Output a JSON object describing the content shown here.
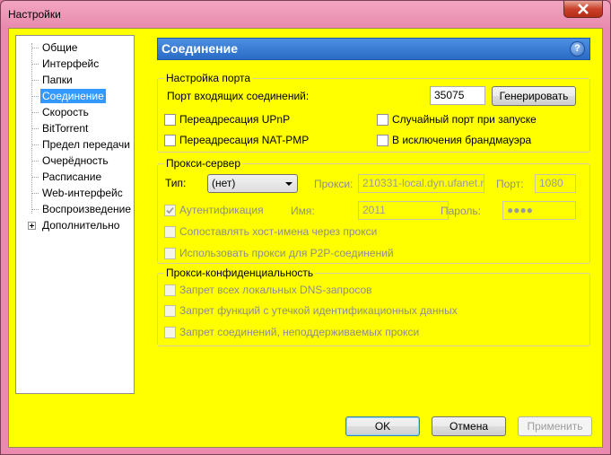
{
  "window": {
    "title": "Настройки"
  },
  "sidebar": {
    "items": [
      {
        "label": "Общие"
      },
      {
        "label": "Интерфейс"
      },
      {
        "label": "Папки"
      },
      {
        "label": "Соединение"
      },
      {
        "label": "Скорость"
      },
      {
        "label": "BitTorrent"
      },
      {
        "label": "Предел передачи"
      },
      {
        "label": "Очерёдность"
      },
      {
        "label": "Расписание"
      },
      {
        "label": "Web-интерфейс"
      },
      {
        "label": "Воспроизведение"
      },
      {
        "label": "Дополнительно"
      }
    ],
    "selected": "Соединение"
  },
  "header": {
    "title": "Соединение",
    "help": "?"
  },
  "port": {
    "group_label": "Настройка порта",
    "incoming_label": "Порт входящих соединений:",
    "incoming_value": "35075",
    "generate_label": "Генерировать",
    "upnp_label": "Переадресация UPnP",
    "natpmp_label": "Переадресация NAT-PMP",
    "random_label": "Случайный порт при запуске",
    "firewall_label": "В исключения брандмауэра",
    "upnp_checked": false,
    "natpmp_checked": false,
    "random_checked": false,
    "firewall_checked": false
  },
  "proxy": {
    "group_label": "Прокси-сервер",
    "type_label": "Тип:",
    "type_value": "(нет)",
    "proxy_label": "Прокси:",
    "proxy_value": "210331-local.dyn.ufanet.r",
    "port_label": "Порт:",
    "port_value": "1080",
    "auth_label": "Аутентификация",
    "auth_checked": true,
    "name_label": "Имя:",
    "name_value": "2011",
    "password_label": "Пароль:",
    "password_value": "●●●●",
    "resolve_label": "Сопоставлять хост-имена через прокси",
    "p2p_label": "Использовать прокси для P2P-соединений"
  },
  "privacy": {
    "group_label": "Прокси-конфиденциальность",
    "dns_label": "Запрет всех локальных DNS-запросов",
    "leak_label": "Запрет функций с утечкой идентификационных данных",
    "unsupported_label": "Запрет соединений, неподдерживаемых прокси"
  },
  "footer": {
    "ok_label": "OK",
    "cancel_label": "Отмена",
    "apply_label": "Применить"
  },
  "colors": {
    "background": "#ffff00",
    "header": "#2a6cc6",
    "title_bar": "#e98aae",
    "selection": "#3399ff"
  }
}
